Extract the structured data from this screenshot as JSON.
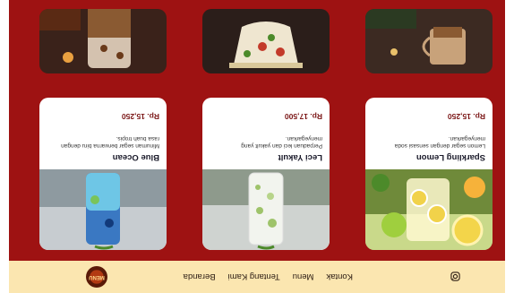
{
  "navbar": {
    "logo_text": "MENU",
    "links": [
      "Beranda",
      "Tentang Kami",
      "Menu",
      "Kontak"
    ],
    "social_icon": "instagram-icon"
  },
  "menu_cards": [
    {
      "title": "Blue Ocean",
      "desc_line1": "Minuman segar berwarna biru dengan",
      "desc_line2": "rasa buah tropis.",
      "price": "Rp. 15,250",
      "image": "blue-drink"
    },
    {
      "title": "Leci Yakult",
      "desc_line1": "Perpaduan leci dan yakult yang",
      "desc_line2": "menyegarkan.",
      "price": "Rp. 17,500",
      "image": "lychee-drink"
    },
    {
      "title": "Sparkling Lemon",
      "desc_line1": "Lemon segar dengan sensasi soda",
      "desc_line2": "menyegarkan.",
      "price": "Rp. 15,250",
      "image": "lemon-drink"
    }
  ],
  "top_cards": [
    "coffee-glass",
    "floral-teacup",
    "coffee-mug"
  ],
  "colors": {
    "background": "#9e1212",
    "navbar": "#fbe6b0",
    "price": "#7a1515"
  }
}
